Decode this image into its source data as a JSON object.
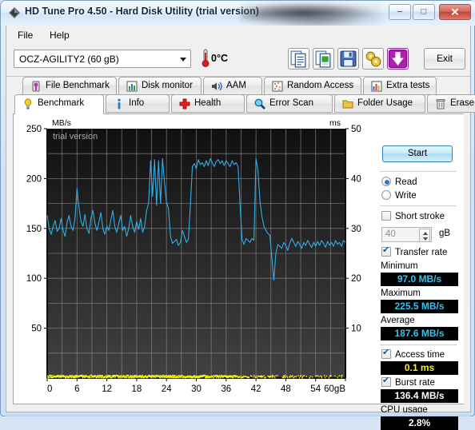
{
  "window": {
    "title": "HD Tune Pro 4.50 - Hard Disk Utility (trial version)",
    "icon": "app-diamond-icon",
    "minimize_label": "–",
    "maximize_label": "□",
    "close_label": "✕"
  },
  "menu": {
    "file": "File",
    "help": "Help"
  },
  "toolbar": {
    "drive": "OCZ-AGILITY2 (60 gB)",
    "temperature": "0°C",
    "exit_label": "Exit",
    "buttons": [
      {
        "name": "copy-text-icon"
      },
      {
        "name": "copy-image-icon"
      },
      {
        "name": "save-icon"
      },
      {
        "name": "settings-icon"
      },
      {
        "name": "download-icon"
      }
    ]
  },
  "tabs_row1": [
    {
      "label": "File Benchmark",
      "icon": "file-benchmark-icon",
      "active": false
    },
    {
      "label": "Disk monitor",
      "icon": "disk-monitor-icon",
      "active": false
    },
    {
      "label": "AAM",
      "icon": "aam-speaker-icon",
      "active": false
    },
    {
      "label": "Random Access",
      "icon": "random-access-icon",
      "active": false
    },
    {
      "label": "Extra tests",
      "icon": "extra-tests-icon",
      "active": false
    }
  ],
  "tabs_row2": [
    {
      "label": "Benchmark",
      "icon": "benchmark-bulb-icon",
      "active": true
    },
    {
      "label": "Info",
      "icon": "info-icon",
      "active": false
    },
    {
      "label": "Health",
      "icon": "health-cross-icon",
      "active": false
    },
    {
      "label": "Error Scan",
      "icon": "error-scan-icon",
      "active": false
    },
    {
      "label": "Folder Usage",
      "icon": "folder-usage-icon",
      "active": false
    },
    {
      "label": "Erase",
      "icon": "erase-trash-icon",
      "active": false
    }
  ],
  "panel": {
    "start_label": "Start",
    "mode_read": "Read",
    "mode_write": "Write",
    "mode_selected": "Read",
    "short_stroke_label": "Short stroke",
    "short_stroke_checked": false,
    "short_stroke_value": "40",
    "short_stroke_unit": "gB",
    "transfer_rate_label": "Transfer rate",
    "transfer_rate_checked": true,
    "minimum_label": "Minimum",
    "minimum_value": "97.0 MB/s",
    "maximum_label": "Maximum",
    "maximum_value": "225.5 MB/s",
    "average_label": "Average",
    "average_value": "187.6 MB/s",
    "access_time_label": "Access time",
    "access_time_checked": true,
    "access_time_value": "0.1 ms",
    "burst_rate_label": "Burst rate",
    "burst_rate_checked": true,
    "burst_rate_value": "136.4 MB/s",
    "cpu_usage_label": "CPU usage",
    "cpu_usage_value": "2.8%"
  },
  "colors": {
    "transfer_line": "#31aee8",
    "access_dot": "#ffff00",
    "plot_bg_top": "#111111",
    "plot_bg_bottom": "#3c3c3c",
    "grid": "#8d8d8d",
    "value_cyan": "#2fc4f0",
    "value_yellow": "#f2f21e",
    "accent_blue": "#2a78c0"
  },
  "chart_data": {
    "type": "line",
    "title": "",
    "watermark": "trial version",
    "xlabel": "",
    "ylabel": "MB/s",
    "y2label": "ms",
    "xlim": [
      0,
      60
    ],
    "ylim": [
      0,
      250
    ],
    "y2lim": [
      0,
      50
    ],
    "x_unit": "gB",
    "x_ticks": [
      0,
      6,
      12,
      18,
      24,
      30,
      36,
      42,
      48,
      54,
      60
    ],
    "x_tick_labels": [
      "0",
      "6",
      "12",
      "18",
      "24",
      "30",
      "36",
      "42",
      "48",
      "54",
      "60gB"
    ],
    "y_ticks": [
      50,
      100,
      150,
      200,
      250
    ],
    "y_tick_labels": [
      "50",
      "100",
      "150",
      "200",
      "250"
    ],
    "y2_ticks": [
      10,
      20,
      30,
      40,
      50
    ],
    "y2_tick_labels": [
      "10",
      "20",
      "30",
      "40",
      "50"
    ],
    "grid": true,
    "legend": "none",
    "series": [
      {
        "name": "Transfer rate",
        "axis": "left",
        "units": "MB/s",
        "color": "#31aee8",
        "x": [
          0.0,
          0.4,
          0.8,
          1.2,
          1.6,
          2.0,
          2.4,
          2.8,
          3.2,
          3.6,
          4.0,
          4.4,
          4.8,
          5.2,
          5.6,
          6.0,
          6.4,
          6.8,
          7.2,
          7.6,
          8.0,
          8.4,
          8.8,
          9.2,
          9.6,
          10.0,
          10.4,
          10.8,
          11.2,
          11.6,
          12.0,
          12.4,
          12.8,
          13.2,
          13.6,
          14.0,
          14.4,
          14.8,
          15.2,
          15.6,
          16.0,
          16.4,
          16.8,
          17.2,
          17.6,
          18.0,
          18.4,
          18.8,
          19.2,
          19.6,
          20.0,
          20.4,
          20.8,
          21.2,
          21.6,
          22.0,
          22.4,
          22.8,
          23.2,
          23.6,
          24.0,
          24.4,
          24.8,
          25.2,
          25.6,
          26.0,
          26.4,
          26.8,
          27.2,
          27.6,
          28.0,
          28.4,
          28.8,
          29.2,
          29.6,
          30.0,
          30.4,
          30.8,
          31.2,
          31.6,
          32.0,
          32.4,
          32.8,
          33.2,
          33.6,
          34.0,
          34.4,
          34.8,
          35.2,
          35.6,
          36.0,
          36.4,
          36.8,
          37.2,
          37.6,
          38.0,
          38.4,
          38.8,
          39.2,
          39.6,
          40.0,
          40.4,
          40.8,
          41.2,
          41.6,
          42.0,
          42.4,
          42.8,
          43.2,
          43.6,
          44.0,
          44.4,
          44.8,
          45.2,
          45.6,
          46.0,
          46.4,
          46.8,
          47.2,
          47.6,
          48.0,
          48.4,
          48.8,
          49.2,
          49.6,
          50.0,
          50.4,
          50.8,
          51.2,
          51.6,
          52.0,
          52.4,
          52.8,
          53.2,
          53.6,
          54.0,
          54.4,
          54.8,
          55.2,
          55.6,
          56.0,
          56.4,
          56.8,
          57.2,
          57.6,
          58.0,
          58.4,
          58.8,
          59.2,
          59.6,
          60.0
        ],
        "y": [
          163,
          150,
          144,
          152,
          158,
          147,
          150,
          160,
          148,
          142,
          156,
          163,
          152,
          148,
          160,
          190,
          171,
          157,
          152,
          164,
          150,
          145,
          160,
          168,
          155,
          148,
          156,
          166,
          150,
          144,
          152,
          148,
          158,
          168,
          152,
          146,
          155,
          163,
          148,
          152,
          142,
          150,
          163,
          152,
          146,
          157,
          149,
          160,
          146,
          152,
          168,
          175,
          218,
          182,
          219,
          173,
          218,
          175,
          220,
          196,
          176,
          170,
          142,
          135,
          137,
          139,
          133,
          136,
          148,
          142,
          136,
          139,
          172,
          212,
          215,
          210,
          219,
          214,
          216,
          212,
          218,
          213,
          220,
          216,
          212,
          217,
          219,
          215,
          218,
          213,
          218,
          215,
          212,
          218,
          214,
          216,
          212,
          174,
          139,
          134,
          140,
          138,
          136,
          140,
          138,
          220,
          208,
          178,
          162,
          152,
          148,
          145,
          143,
          120,
          98,
          125,
          134,
          132,
          130,
          136,
          133,
          128,
          135,
          140,
          136,
          132,
          137,
          134,
          130,
          136,
          133,
          138,
          134,
          131,
          136,
          132,
          137,
          133,
          138,
          135,
          131,
          137,
          133,
          136,
          132,
          138,
          134,
          136,
          132,
          138,
          136
        ]
      },
      {
        "name": "Access time",
        "axis": "right",
        "units": "ms",
        "color": "#ffff00",
        "constant_value": 0.1,
        "note": "dense scatter of dots along baseline (~0.1 ms), denser in first 40 gB"
      }
    ]
  }
}
